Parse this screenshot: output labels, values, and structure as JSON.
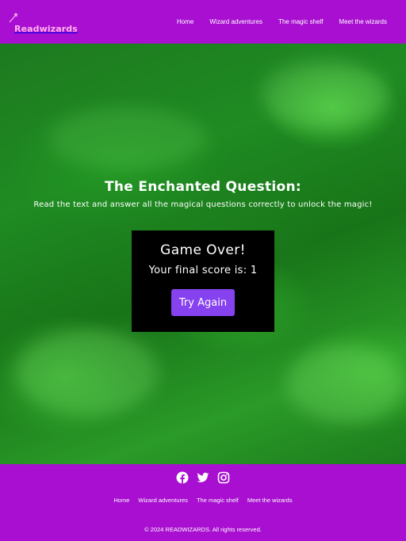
{
  "header": {
    "logo_text": "Readwizards",
    "nav": [
      "Home",
      "Wizard adventures",
      "The magic shelf",
      "Meet the wizards"
    ]
  },
  "hero": {
    "title": "The Enchanted Question:",
    "subtitle": "Read the text and answer all the magical questions correctly to unlock the magic!"
  },
  "game": {
    "status": "Game Over!",
    "score_text": "Your final score is: 1",
    "button_label": "Try Again"
  },
  "footer": {
    "socials": [
      "facebook-icon",
      "twitter-icon",
      "instagram-icon"
    ],
    "nav": [
      "Home",
      "Wizard adventures",
      "The magic shelf",
      "Meet the wizards"
    ],
    "copyright": "© 2024 READWIZARDS. All rights reserved."
  },
  "colors": {
    "brand_purple": "#a80fd0",
    "button_purple": "#8742f0",
    "logo_pink": "#ffb4ee",
    "hero_green": "#1f8b22"
  }
}
